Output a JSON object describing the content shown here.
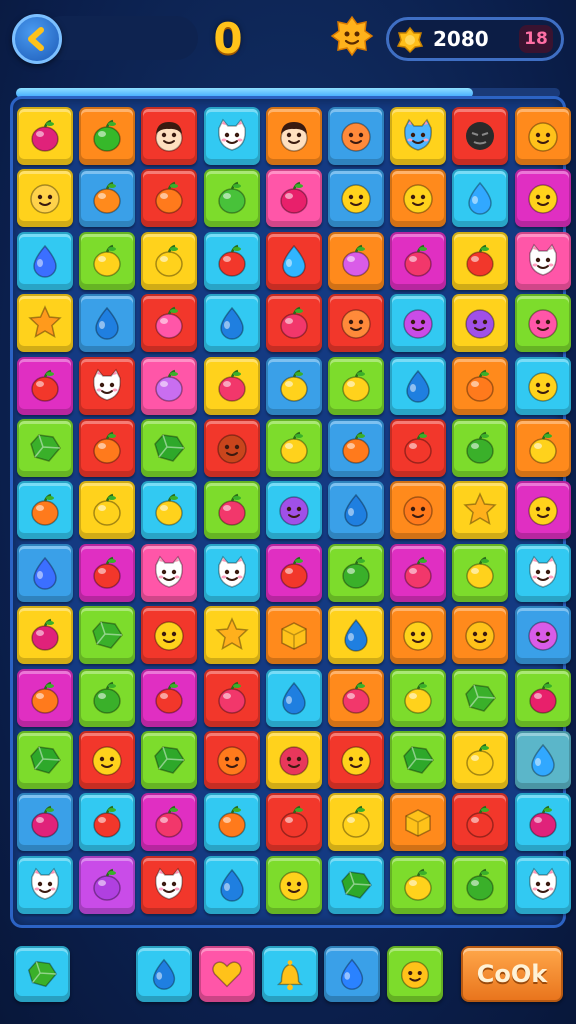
{
  "header": {
    "score": "0",
    "coins": "2080",
    "level_badge": "18",
    "back_icon": "chevron-left-icon",
    "mascot_icon": "star-face-icon",
    "coin_icon": "gold-coin-icon"
  },
  "progress": {
    "fraction": 0.84
  },
  "colors": {
    "pink": "#ff56a8",
    "green": "#7ddc2c",
    "red": "#f2372b",
    "cyan": "#32c9f2",
    "orange": "#ff8a1c",
    "blue": "#3aa0e8",
    "yellow": "#ffd21c",
    "magenta": "#e02fc2",
    "teal": "#5bb6c9",
    "violet": "#c94ce8"
  },
  "board": {
    "columns": 9,
    "rows": [
      [
        [
          "yellow",
          "fruit",
          "#e0227a"
        ],
        [
          "orange",
          "fruit",
          "#36b82a"
        ],
        [
          "red",
          "boy",
          "#ffe0c0"
        ],
        [
          "cyan",
          "cat",
          "#ffffff"
        ],
        [
          "orange",
          "boy",
          "#ffe0c0"
        ],
        [
          "blue",
          "face",
          "#ff8a3a"
        ],
        [
          "yellow",
          "cat",
          "#4fb6ff"
        ],
        [
          "red",
          "ball",
          "#2a2a2a"
        ],
        [
          "orange",
          "face",
          "#ffc21a"
        ]
      ],
      [
        [
          "yellow",
          "face",
          "#ffd24a"
        ],
        [
          "blue",
          "fruit",
          "#ff8a1c"
        ],
        [
          "red",
          "fruit",
          "#ff7a1c"
        ],
        [
          "green",
          "fruit",
          "#48c23a"
        ],
        [
          "pink",
          "fruit",
          "#e8206b"
        ],
        [
          "blue",
          "face",
          "#ffd21c"
        ],
        [
          "orange",
          "face",
          "#ffd21c"
        ],
        [
          "cyan",
          "drop",
          "#31a8ff"
        ],
        [
          "magenta",
          "face",
          "#ffd21c"
        ]
      ],
      [
        [
          "cyan",
          "drop",
          "#3b6fff"
        ],
        [
          "green",
          "fruit",
          "#ffd21c"
        ],
        [
          "yellow",
          "fruit",
          "#ffd21c"
        ],
        [
          "cyan",
          "fruit",
          "#f2372b"
        ],
        [
          "red",
          "drop",
          "#31b5ff"
        ],
        [
          "orange",
          "fruit",
          "#d95ce8"
        ],
        [
          "magenta",
          "fruit",
          "#f2376b"
        ],
        [
          "yellow",
          "fruit",
          "#f2372b"
        ],
        [
          "pink",
          "cat",
          "#ffffff"
        ]
      ],
      [
        [
          "yellow",
          "star",
          "#ff9a1c"
        ],
        [
          "blue",
          "drop",
          "#1f7fe0"
        ],
        [
          "red",
          "fruit",
          "#ff56a8"
        ],
        [
          "cyan",
          "drop",
          "#1f7fe0"
        ],
        [
          "red",
          "fruit",
          "#f2376b"
        ],
        [
          "red",
          "face",
          "#ff8a3a"
        ],
        [
          "cyan",
          "face",
          "#c94ce8"
        ],
        [
          "yellow",
          "face",
          "#a050e8"
        ],
        [
          "green",
          "face",
          "#ff56a8"
        ]
      ],
      [
        [
          "magenta",
          "fruit",
          "#f2372b"
        ],
        [
          "red",
          "cat",
          "#ffffff"
        ],
        [
          "pink",
          "fruit",
          "#c96ef0"
        ],
        [
          "yellow",
          "fruit",
          "#f2376b"
        ],
        [
          "blue",
          "fruit",
          "#ffd21c"
        ],
        [
          "green",
          "fruit",
          "#ffd21c"
        ],
        [
          "cyan",
          "drop",
          "#1f7fe0"
        ],
        [
          "orange",
          "fruit",
          "#ff7a1c"
        ],
        [
          "cyan",
          "face",
          "#ffd21c"
        ]
      ],
      [
        [
          "green",
          "gem",
          "#3ab02a"
        ],
        [
          "red",
          "fruit",
          "#ff7a1c"
        ],
        [
          "green",
          "gem",
          "#2ea82a"
        ],
        [
          "red",
          "face",
          "#c9451c"
        ],
        [
          "green",
          "fruit",
          "#ffd21c"
        ],
        [
          "blue",
          "fruit",
          "#ff7a1c"
        ],
        [
          "red",
          "fruit",
          "#f2372b"
        ],
        [
          "green",
          "fruit",
          "#3ab02a"
        ],
        [
          "orange",
          "fruit",
          "#ffd21c"
        ]
      ],
      [
        [
          "cyan",
          "fruit",
          "#ff7a1c"
        ],
        [
          "yellow",
          "fruit",
          "#ffd21c"
        ],
        [
          "cyan",
          "fruit",
          "#ffd21c"
        ],
        [
          "green",
          "fruit",
          "#f2376b"
        ],
        [
          "cyan",
          "face",
          "#a050e8"
        ],
        [
          "blue",
          "drop",
          "#1f7fe0"
        ],
        [
          "orange",
          "face",
          "#ff7a1c"
        ],
        [
          "yellow",
          "star",
          "#ffb01c"
        ],
        [
          "magenta",
          "face",
          "#ffd21c"
        ]
      ],
      [
        [
          "blue",
          "drop",
          "#3b6fff"
        ],
        [
          "magenta",
          "fruit",
          "#f2372b"
        ],
        [
          "pink",
          "cat",
          "#ffffff"
        ],
        [
          "cyan",
          "cat",
          "#ffffff"
        ],
        [
          "magenta",
          "fruit",
          "#f2372b"
        ],
        [
          "green",
          "fruit",
          "#3ab02a"
        ],
        [
          "magenta",
          "fruit",
          "#f2376b"
        ],
        [
          "green",
          "fruit",
          "#ffd21c"
        ],
        [
          "cyan",
          "cat",
          "#ffffff"
        ]
      ],
      [
        [
          "yellow",
          "fruit",
          "#e0227a"
        ],
        [
          "green",
          "gem",
          "#3ab02a"
        ],
        [
          "red",
          "face",
          "#ffd21c"
        ],
        [
          "yellow",
          "star",
          "#ffb01c"
        ],
        [
          "orange",
          "box",
          "#ffc21a"
        ],
        [
          "yellow",
          "drop",
          "#1f7fe0"
        ],
        [
          "orange",
          "face",
          "#ffd21c"
        ],
        [
          "orange",
          "face",
          "#ffc21a"
        ],
        [
          "blue",
          "face",
          "#d95ce8"
        ]
      ],
      [
        [
          "magenta",
          "fruit",
          "#ff7a1c"
        ],
        [
          "green",
          "fruit",
          "#3ab02a"
        ],
        [
          "magenta",
          "fruit",
          "#f2372b"
        ],
        [
          "red",
          "fruit",
          "#f2376b"
        ],
        [
          "cyan",
          "drop",
          "#1f7fe0"
        ],
        [
          "orange",
          "fruit",
          "#f2376b"
        ],
        [
          "green",
          "fruit",
          "#ffd21c"
        ],
        [
          "green",
          "gem",
          "#3ab02a"
        ],
        [
          "green",
          "fruit",
          "#e8206b"
        ]
      ],
      [
        [
          "green",
          "gem",
          "#2ea82a"
        ],
        [
          "red",
          "face",
          "#ffd21c"
        ],
        [
          "green",
          "gem",
          "#2ea82a"
        ],
        [
          "red",
          "face",
          "#ff7a1c"
        ],
        [
          "yellow",
          "face",
          "#e8375b"
        ],
        [
          "red",
          "face",
          "#ffd21c"
        ],
        [
          "green",
          "gem",
          "#2ea82a"
        ],
        [
          "yellow",
          "fruit",
          "#ffd21c"
        ],
        [
          "teal",
          "drop",
          "#31a8ff"
        ]
      ],
      [
        [
          "blue",
          "fruit",
          "#e0227a"
        ],
        [
          "cyan",
          "fruit",
          "#f2372b"
        ],
        [
          "magenta",
          "fruit",
          "#f2376b"
        ],
        [
          "cyan",
          "fruit",
          "#ff7a1c"
        ],
        [
          "red",
          "fruit",
          "#f2372b"
        ],
        [
          "yellow",
          "fruit",
          "#ffd21c"
        ],
        [
          "orange",
          "box",
          "#ffc21a"
        ],
        [
          "red",
          "fruit",
          "#f2372b"
        ],
        [
          "cyan",
          "fruit",
          "#e0227a"
        ]
      ],
      [
        [
          "cyan",
          "cat",
          "#ffffff"
        ],
        [
          "violet",
          "fruit",
          "#b040e0"
        ],
        [
          "red",
          "cat",
          "#ffffff"
        ],
        [
          "cyan",
          "drop",
          "#1f7fe0"
        ],
        [
          "green",
          "face",
          "#ffd21c"
        ],
        [
          "cyan",
          "gem",
          "#2ea82a"
        ],
        [
          "green",
          "fruit",
          "#ffd21c"
        ],
        [
          "green",
          "fruit",
          "#3ab02a"
        ],
        [
          "cyan",
          "cat",
          "#ffffff"
        ]
      ]
    ]
  },
  "boosters": [
    [
      "cyan",
      "gem",
      "#3ab02a"
    ],
    [
      "cyan",
      "drop",
      "#1f7fe0"
    ],
    [
      "pink",
      "heart",
      "#ffc21a"
    ],
    [
      "cyan",
      "bell",
      "#ffc21a"
    ],
    [
      "blue",
      "drop",
      "#2a82ff"
    ],
    [
      "green",
      "face",
      "#ffc21a"
    ]
  ],
  "action_button": {
    "label": "CoOk"
  }
}
